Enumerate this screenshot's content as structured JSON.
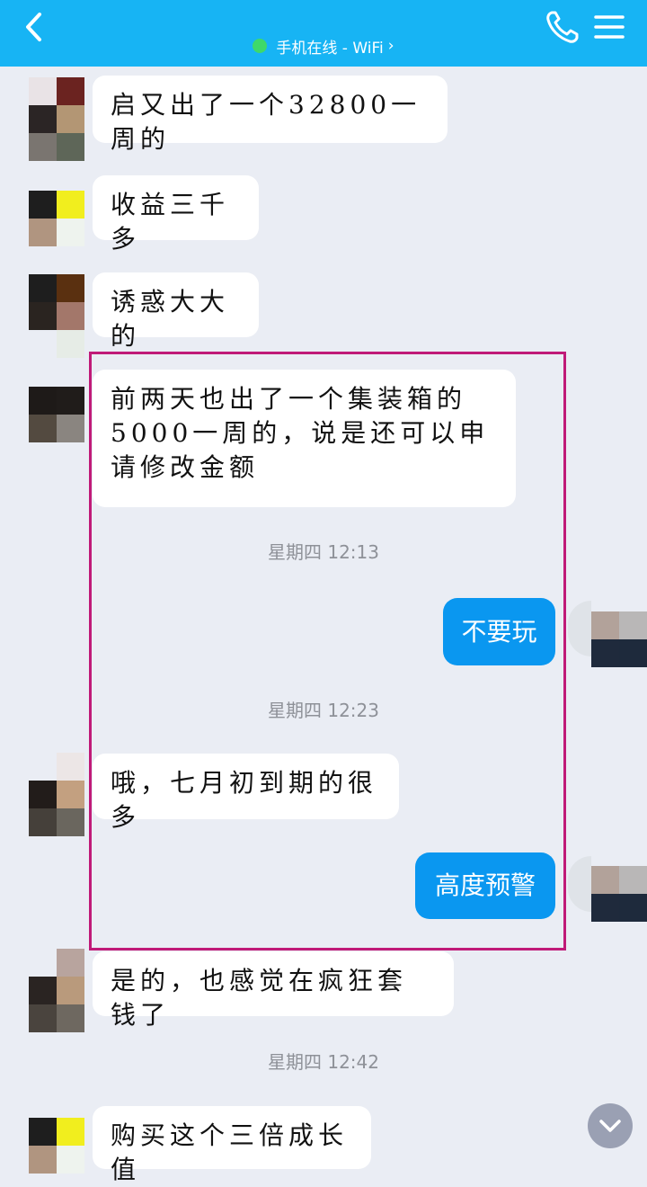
{
  "header": {
    "status": "手机在线 - WiFi",
    "status_chevron": "›",
    "icons": [
      "back-icon",
      "phone-icon",
      "menu-icon"
    ]
  },
  "messages": [
    {
      "side": "in",
      "text": "启又出了一个32800一周的"
    },
    {
      "side": "in",
      "text": "收益三千多"
    },
    {
      "side": "in",
      "text": "诱惑大大的"
    },
    {
      "side": "in",
      "text": "前两天也出了一个集装箱的5000一周的，说是还可以申请修改金额"
    },
    {
      "side": "time",
      "text": "星期四 12:13"
    },
    {
      "side": "out",
      "text": "不要玩"
    },
    {
      "side": "time",
      "text": "星期四 12:23"
    },
    {
      "side": "in",
      "text": "哦，七月初到期的很多"
    },
    {
      "side": "out",
      "text": "高度预警"
    },
    {
      "side": "in",
      "text": "是的，也感觉在疯狂套钱了"
    },
    {
      "side": "time",
      "text": "星期四 12:42"
    },
    {
      "side": "in",
      "text": "购买这个三倍成长值"
    }
  ],
  "colors": {
    "header_bg": "#17b4f4",
    "outgoing_bubble": "#0a97f0",
    "highlight_frame": "#c01a78"
  }
}
